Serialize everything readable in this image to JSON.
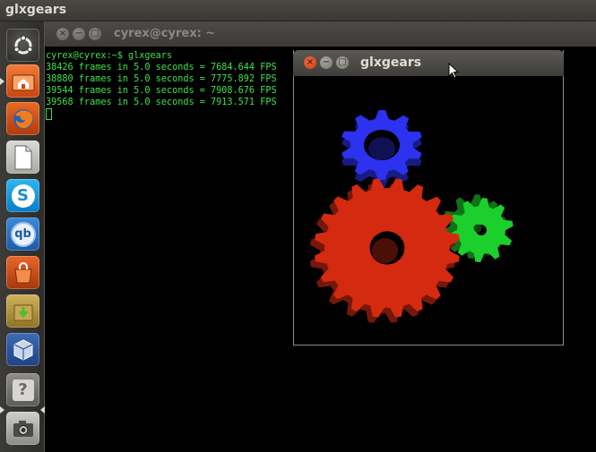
{
  "top_panel": {
    "app_title": "glxgears"
  },
  "launcher": {
    "items": [
      {
        "name": "dash",
        "icon": "ubuntu-logo-icon"
      },
      {
        "name": "home-folder",
        "icon": "home-folder-icon"
      },
      {
        "name": "firefox",
        "icon": "firefox-icon"
      },
      {
        "name": "libreoffice",
        "icon": "document-icon"
      },
      {
        "name": "skype",
        "icon": "skype-icon",
        "glyph": "S"
      },
      {
        "name": "qbittorrent",
        "icon": "qbittorrent-icon",
        "glyph": "qb"
      },
      {
        "name": "software-center",
        "icon": "shopping-bag-icon"
      },
      {
        "name": "update-manager",
        "icon": "download-box-icon"
      },
      {
        "name": "virtualbox",
        "icon": "virtualbox-icon"
      },
      {
        "name": "help",
        "icon": "help-icon",
        "glyph": "?"
      },
      {
        "name": "screenshot",
        "icon": "camera-icon"
      }
    ]
  },
  "terminal": {
    "title": "cyrex@cyrex: ~",
    "lines": [
      "cyrex@cyrex:~$ glxgears",
      "38426 frames in 5.0 seconds = 7684.644 FPS",
      "38880 frames in 5.0 seconds = 7775.892 FPS",
      "39544 frames in 5.0 seconds = 7908.676 FPS",
      "39568 frames in 5.0 seconds = 7913.571 FPS"
    ]
  },
  "glxgears": {
    "title": "glxgears",
    "gear_colors": {
      "red": "#d42a10",
      "green": "#1bd02c",
      "blue": "#2d31f0"
    }
  },
  "window_buttons": {
    "close_glyph": "×",
    "minimize_glyph": "−",
    "maximize_glyph": "□"
  }
}
